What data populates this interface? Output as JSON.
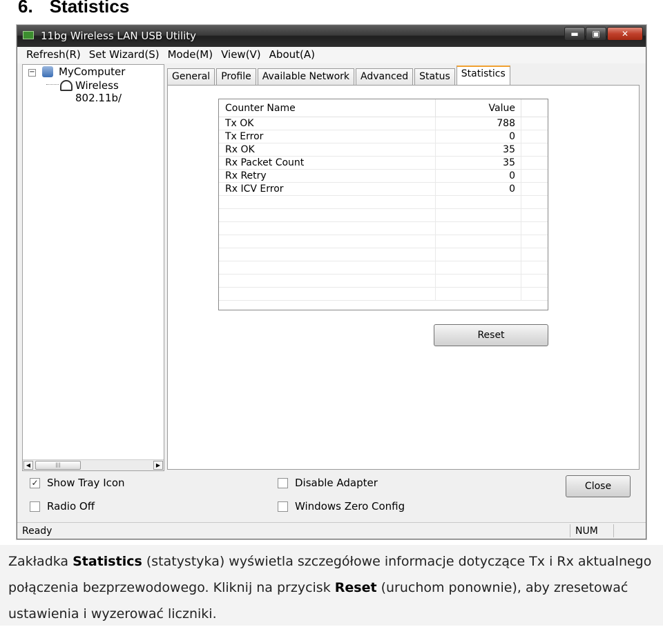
{
  "heading": {
    "number": "6.",
    "title": "Statistics"
  },
  "window": {
    "title": "11bg Wireless LAN USB Utility",
    "controls": {
      "minimize": "▬",
      "maximize": "▣",
      "close": "✕"
    }
  },
  "menu": [
    "Refresh(R)",
    "Set Wizard(S)",
    "Mode(M)",
    "View(V)",
    "About(A)"
  ],
  "tree": {
    "root": "MyComputer",
    "child": "Wireless 802.11b/"
  },
  "tabs": [
    "General",
    "Profile",
    "Available Network",
    "Advanced",
    "Status",
    "Statistics"
  ],
  "active_tab": "Statistics",
  "statistics": {
    "col_name": "Counter Name",
    "col_value": "Value",
    "rows": [
      {
        "name": "Tx OK",
        "value": "788"
      },
      {
        "name": "Tx Error",
        "value": "0"
      },
      {
        "name": "Rx OK",
        "value": "35"
      },
      {
        "name": "Rx Packet Count",
        "value": "35"
      },
      {
        "name": "Rx Retry",
        "value": "0"
      },
      {
        "name": "Rx ICV Error",
        "value": "0"
      }
    ],
    "reset_label": "Reset"
  },
  "options": {
    "show_tray_icon": {
      "label": "Show Tray Icon",
      "checked": "✓"
    },
    "radio_off": {
      "label": "Radio Off",
      "checked": ""
    },
    "disable_adapter": {
      "label": "Disable Adapter",
      "checked": ""
    },
    "windows_zero_config": {
      "label": "Windows Zero Config",
      "checked": ""
    }
  },
  "close_label": "Close",
  "statusbar": {
    "status": "Ready",
    "num": "NUM"
  },
  "caption": {
    "p1": "Zakładka ",
    "b1": "Statistics",
    "p2": " (statystyka) wyświetla szczegółowe informacje dotyczące Tx i Rx aktualnego połączenia bezprzewodowego. Kliknij na przycisk ",
    "b2": "Reset",
    "p3": " (uruchom ponownie), aby zresetować ustawienia i wyzerować liczniki."
  }
}
